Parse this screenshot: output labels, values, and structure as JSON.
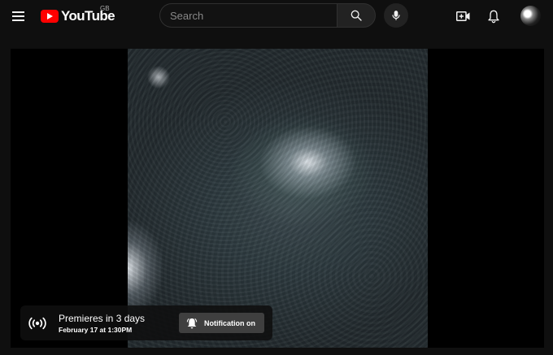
{
  "header": {
    "logo_text": "YouTube",
    "country_code": "GB",
    "search": {
      "placeholder": "Search",
      "value": ""
    },
    "icons": {
      "menu": "hamburger-menu-icon",
      "search": "search-icon",
      "mic": "microphone-icon",
      "create": "create-video-icon",
      "notifications": "bell-icon",
      "avatar": "user-avatar"
    }
  },
  "player": {
    "premiere": {
      "title": "Premieres in 3 days",
      "date": "February 17 at 1:30PM",
      "notification_label": "Notification on",
      "icon": "live-broadcast-icon"
    }
  },
  "colors": {
    "background": "#0f0f0f",
    "brand_red": "#ff0000",
    "button_bg": "#3f3f3f"
  }
}
